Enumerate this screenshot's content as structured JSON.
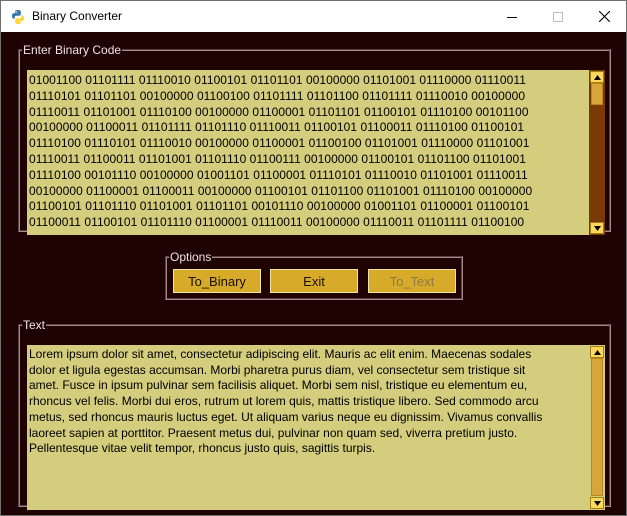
{
  "window": {
    "title": "Binary Converter"
  },
  "binary_frame": {
    "legend": "Enter Binary Code",
    "lines": [
      "01001100 01101111 01110010 01100101 01101101 00100000 01101001 01110000 01110011",
      "01110101 01101101 00100000 01100100 01101111 01101100 01101111 01110010 00100000",
      "01110011 01101001 01110100 00100000 01100001 01101101 01100101 01110100 00101100",
      "00100000 01100011 01101111 01101110 01110011 01100101 01100011 01110100 01100101",
      "01110100 01110101 01110010 00100000 01100001 01100100 01101001 01110000 01101001",
      "01110011 01100011 01101001 01101110 01100111 00100000 01100101 01101100 01101001",
      "01110100 00101110 00100000 01001101 01100001 01110101 01110010 01101001 01110011",
      "00100000 01100001 01100011 00100000 01100101 01101100 01101001 01110100 00100000",
      "01100101 01101110 01101001 01101101 00101110 00100000 01001101 01100001 01100101",
      "01100011 01100101 01101110 01100001 01110011 00100000 01110011 01101111 01100100"
    ]
  },
  "options_frame": {
    "legend": "Options",
    "to_binary_label": "To_Binary",
    "exit_label": "Exit",
    "to_text_label": "To_Text"
  },
  "text_frame": {
    "legend": "Text",
    "lines": [
      "Lorem ipsum dolor sit amet, consectetur adipiscing elit. Mauris ac elit enim. Maecenas sodales",
      "dolor et ligula egestas accumsan. Morbi pharetra purus diam, vel consectetur sem tristique sit",
      "amet. Fusce in ipsum pulvinar sem facilisis aliquet. Morbi sem nisl, tristique eu elementum eu,",
      "rhoncus vel felis. Morbi dui eros, rutrum ut lorem quis, mattis tristique libero. Sed commodo arcu",
      "metus, sed rhoncus mauris luctus eget. Ut aliquam varius neque eu dignissim. Vivamus convallis",
      "laoreet sapien at porttitor. Praesent metus dui, pulvinar non quam sed, viverra pretium justo.",
      "Pellentesque vitae velit tempor, rhoncus justo quis, sagittis turpis."
    ]
  },
  "icons": {
    "app": "python-icon",
    "minimize": "minimize-icon",
    "maximize": "maximize-icon",
    "close": "close-icon",
    "scroll_up": "scroll-up-arrow-icon",
    "scroll_down": "scroll-down-arrow-icon"
  },
  "colors": {
    "window_bg": "#1f0303",
    "textarea_bg": "#d3cd7d",
    "button_bg": "#d7aa2a",
    "scroll_trough_dark": "#7a3a08",
    "scroll_thumb": "#d8a53a",
    "disabled_text": "#8e7a45"
  }
}
